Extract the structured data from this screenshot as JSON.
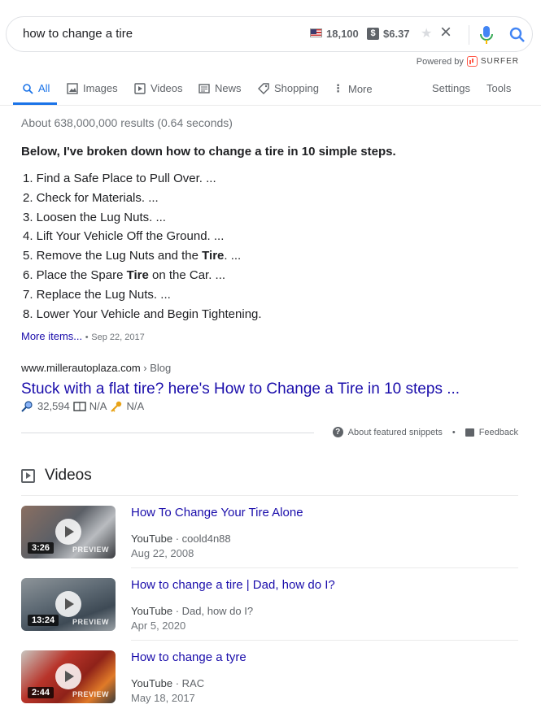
{
  "search": {
    "query": "how to change a tire",
    "search_volume": "18,100",
    "cpc": "$6.37",
    "dollar_icon_text": "$",
    "clear_icon": "×"
  },
  "powered_by": {
    "label": "Powered by",
    "brand": "SURFER",
    "brand_color": "#ff5a4a"
  },
  "tabs": [
    {
      "label": "All",
      "icon": "search-icon",
      "active": true
    },
    {
      "label": "Images",
      "icon": "image-icon"
    },
    {
      "label": "Videos",
      "icon": "play-icon"
    },
    {
      "label": "News",
      "icon": "news-icon"
    },
    {
      "label": "Shopping",
      "icon": "tag-icon"
    },
    {
      "label": "More",
      "icon": "more-vert-icon"
    },
    {
      "label": "Settings"
    },
    {
      "label": "Tools"
    }
  ],
  "result_stats": "About 638,000,000 results (0.64 seconds)",
  "featured_snippet": {
    "heading": "Below, I've broken down how to change a tire in 10 simple steps.",
    "steps": [
      {
        "pre": "1. Find a Safe Place to Pull Over. ...",
        "bold": "",
        "post": ""
      },
      {
        "pre": "2. Check for Materials. ...",
        "bold": "",
        "post": ""
      },
      {
        "pre": "3. Loosen the Lug Nuts. ...",
        "bold": "",
        "post": ""
      },
      {
        "pre": "4. Lift Your Vehicle Off the Ground. ...",
        "bold": "",
        "post": ""
      },
      {
        "pre": "5. Remove the Lug Nuts and the ",
        "bold": "Tire",
        "post": ". ..."
      },
      {
        "pre": "6. Place the Spare ",
        "bold": "Tire",
        "post": " on the Car. ..."
      },
      {
        "pre": "7. Replace the Lug Nuts. ...",
        "bold": "",
        "post": ""
      },
      {
        "pre": "8. Lower Your Vehicle and Begin Tightening.",
        "bold": "",
        "post": ""
      }
    ],
    "more_items": "More items...",
    "date": "Sep 22, 2017",
    "cite_domain": "www.millerautoplaza.com",
    "cite_path": " › Blog",
    "title": "Stuck with a flat tire? here's How to Change a Tire in 10 steps ...",
    "metric_searches": "32,594",
    "metric_book": "N/A",
    "metric_key": "N/A",
    "about_label": "About featured snippets",
    "feedback_label": "Feedback",
    "separator": "•"
  },
  "videos": {
    "heading": "Videos",
    "items": [
      {
        "title": "How To Change Your Tire Alone",
        "platform": "YouTube",
        "channel": " · coold4n88",
        "date": "Aug 22, 2008",
        "duration": "3:26",
        "preview": "PREVIEW",
        "thumb_color": "#6d6a6e"
      },
      {
        "title": "How to change a tire | Dad, how do I?",
        "platform": "YouTube",
        "channel": " · Dad, how do I?",
        "date": "Apr 5, 2020",
        "duration": "13:24",
        "preview": "PREVIEW",
        "thumb_color": "#6c7680"
      },
      {
        "title": "How to change a tyre",
        "platform": "YouTube",
        "channel": " · RAC",
        "date": "May 18, 2017",
        "duration": "2:44",
        "preview": "PREVIEW",
        "thumb_color": "#b23a2c"
      }
    ]
  }
}
